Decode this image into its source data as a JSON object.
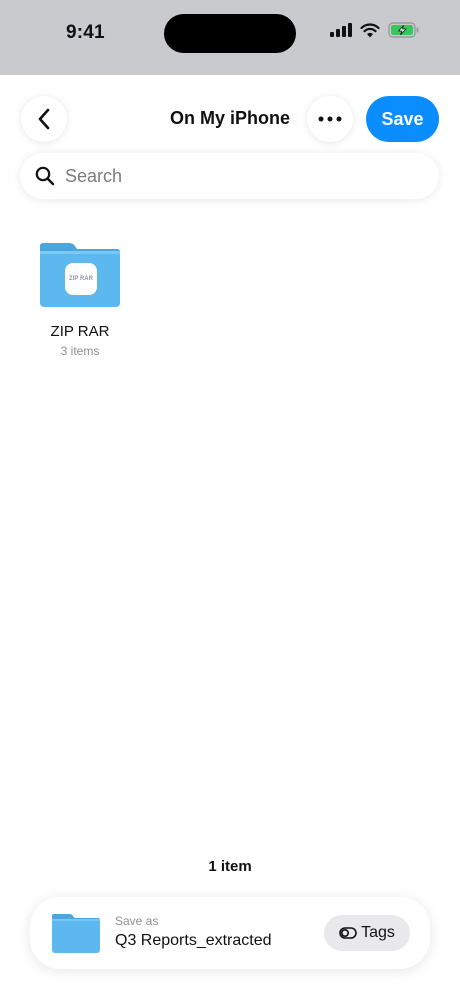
{
  "status_bar": {
    "time": "9:41"
  },
  "nav": {
    "title": "On My iPhone",
    "save_label": "Save",
    "back_icon": "chevron-left-icon",
    "more_icon": "ellipsis-icon"
  },
  "search": {
    "placeholder": "Search",
    "value": ""
  },
  "folders": [
    {
      "name": "ZIP RAR",
      "count": "3 items",
      "badge_text": "ZIP RAR"
    }
  ],
  "footer": {
    "item_count": "1 item",
    "save_as_label": "Save as",
    "filename": "Q3 Reports_extracted",
    "tags_label": "Tags"
  },
  "colors": {
    "accent": "#0a8dff",
    "folder_blue": "#5db8ef",
    "battery_green": "#34c759"
  }
}
